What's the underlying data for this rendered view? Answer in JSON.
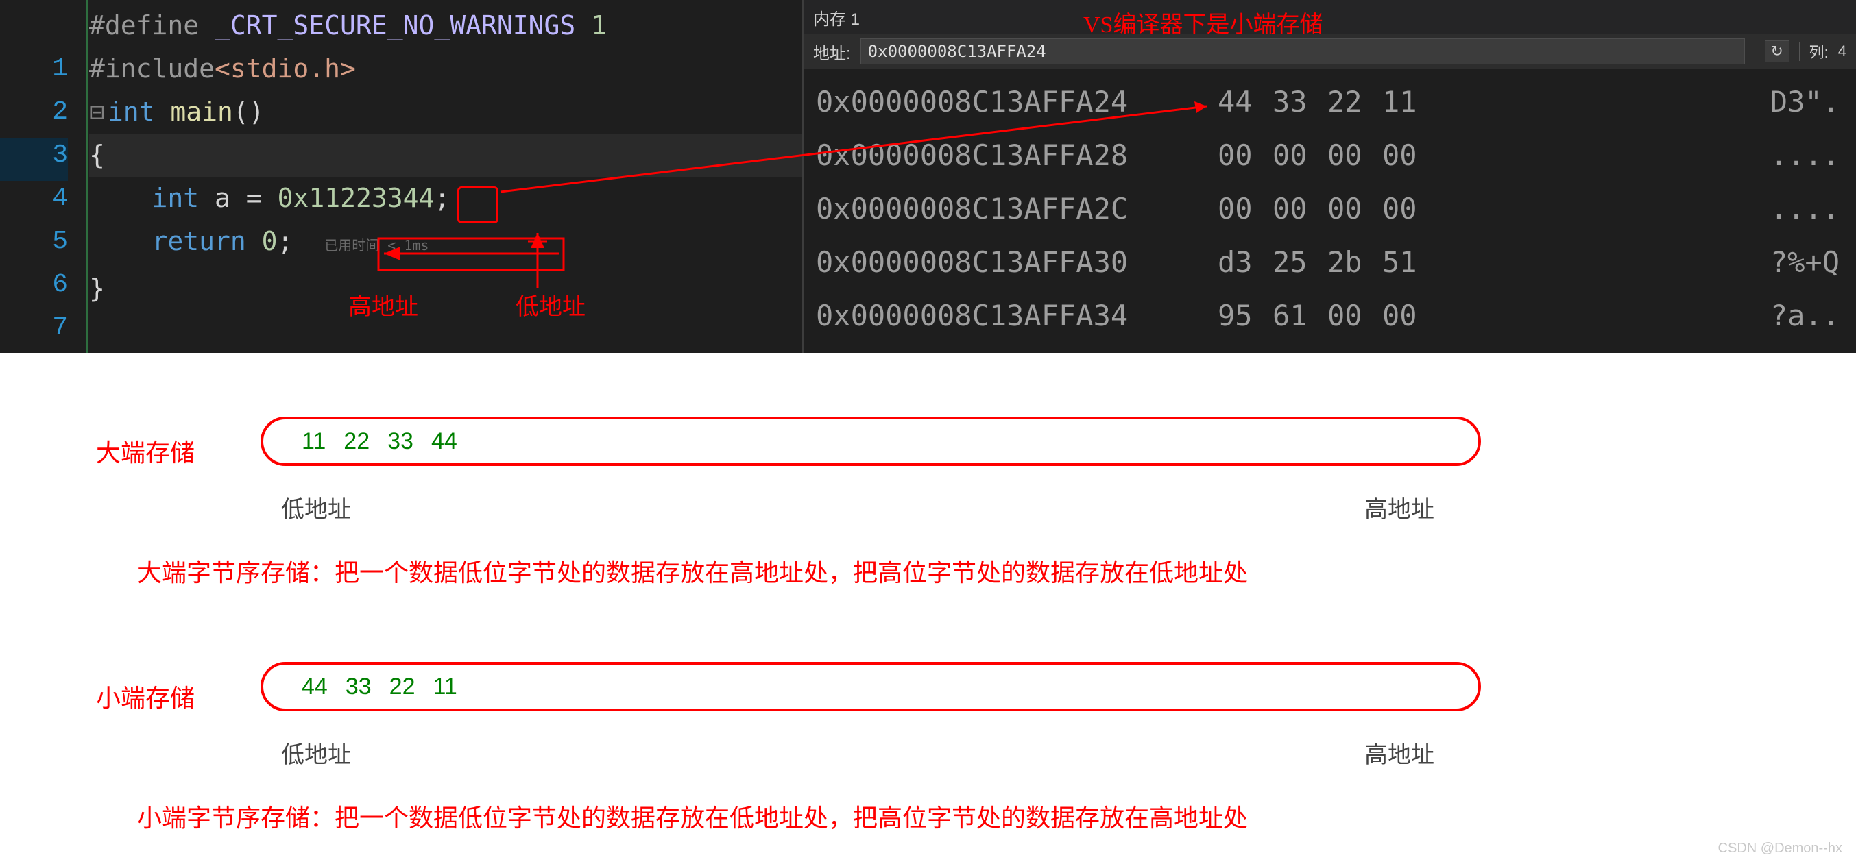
{
  "code": {
    "line1_pp": "#define ",
    "line1_mac": "_CRT_SECURE_NO_WARNINGS",
    "line1_val": " 1",
    "line2_pp": "#include",
    "line2_inc": "<stdio.h>",
    "line3_ty": "int ",
    "line3_fn": "main",
    "line3_par": "()",
    "line4": "{",
    "line5_indent": "    ",
    "line5_ty": "int ",
    "line5_var": "a",
    "line5_eq": " = ",
    "line5_val": "0x11223344",
    "line5_semi": ";",
    "line6_indent": "    ",
    "line6_kw": "return ",
    "line6_val": "0",
    "line6_semi": ";",
    "line6_timing": "已用时间 < 1ms",
    "line7": "}",
    "fold_marker": "⊟"
  },
  "memory": {
    "tab_label": "内存 1",
    "addr_label": "地址:",
    "addr_value": "0x0000008C13AFFA24",
    "col_label": "列:",
    "col_value": "4",
    "rows": [
      {
        "addr": "0x0000008C13AFFA24",
        "b": [
          "44",
          "33",
          "22",
          "11"
        ],
        "ascii": "D3\"."
      },
      {
        "addr": "0x0000008C13AFFA28",
        "b": [
          "00",
          "00",
          "00",
          "00"
        ],
        "ascii": "...."
      },
      {
        "addr": "0x0000008C13AFFA2C",
        "b": [
          "00",
          "00",
          "00",
          "00"
        ],
        "ascii": "...."
      },
      {
        "addr": "0x0000008C13AFFA30",
        "b": [
          "d3",
          "25",
          "2b",
          "51"
        ],
        "ascii": "?%+Q"
      },
      {
        "addr": "0x0000008C13AFFA34",
        "b": [
          "95",
          "61",
          "00",
          "00"
        ],
        "ascii": "?a.."
      }
    ]
  },
  "annotations": {
    "vs_note": "VS编译器下是小端存储",
    "high_addr": "高地址",
    "low_addr": "低地址"
  },
  "big_endian": {
    "title": "大端存储",
    "bytes": [
      "11",
      "22",
      "33",
      "44"
    ],
    "low_label": "低地址",
    "high_label": "高地址",
    "desc": "大端字节序存储：把一个数据低位字节处的数据存放在高地址处，把高位字节处的数据存放在低地址处"
  },
  "little_endian": {
    "title": "小端存储",
    "bytes": [
      "44",
      "33",
      "22",
      "11"
    ],
    "low_label": "低地址",
    "high_label": "高地址",
    "desc": "小端字节序存储：把一个数据低位字节处的数据存放在低地址处，把高位字节处的数据存放在高地址处"
  },
  "watermark": "CSDN @Demon--hx"
}
